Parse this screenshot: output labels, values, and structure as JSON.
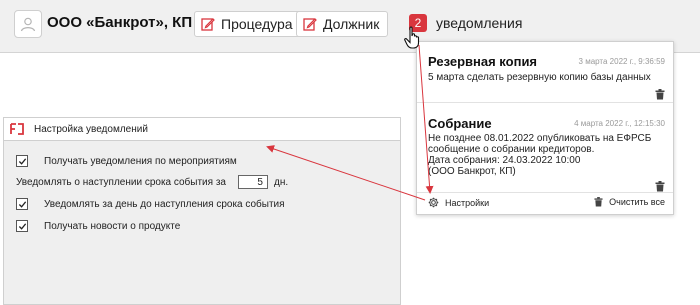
{
  "header": {
    "company": "ООО «Банкрот», КП",
    "procedure_label": "Процедура",
    "debtor_label": "Должник",
    "notif_count": "2",
    "notif_label": "уведомления"
  },
  "notifications": {
    "items": [
      {
        "title": "Резервная копия",
        "date": "3 марта 2022 г., 9:36:59",
        "lines": [
          "5 марта сделать резервную копию базы данных"
        ]
      },
      {
        "title": "Собрание",
        "date": "4 марта 2022 г., 12:15:30",
        "lines": [
          "Не позднее 08.01.2022 опубликовать на ЕФРСБ",
          "сообщение о собрании кредиторов.",
          "Дата собрания: 24.03.2022 10:00",
          "(ООО Банкрот, КП)"
        ]
      }
    ],
    "settings_label": "Настройки",
    "clear_label": "Очистить все"
  },
  "settings_panel": {
    "title": "Настройка уведомлений",
    "opt_events": "Получать уведомления по мероприятиям",
    "deadline_prefix": "Уведомлять о наступлении срока события за",
    "deadline_value": "5",
    "deadline_suffix": "дн.",
    "opt_day_before": "Уведомлять за день до наступления срока события",
    "opt_news": "Получать новости о продукте"
  },
  "colors": {
    "accent_red": "#d9363e",
    "topbar_bg": "#f0f0f0",
    "panel_bg": "#efefef"
  }
}
